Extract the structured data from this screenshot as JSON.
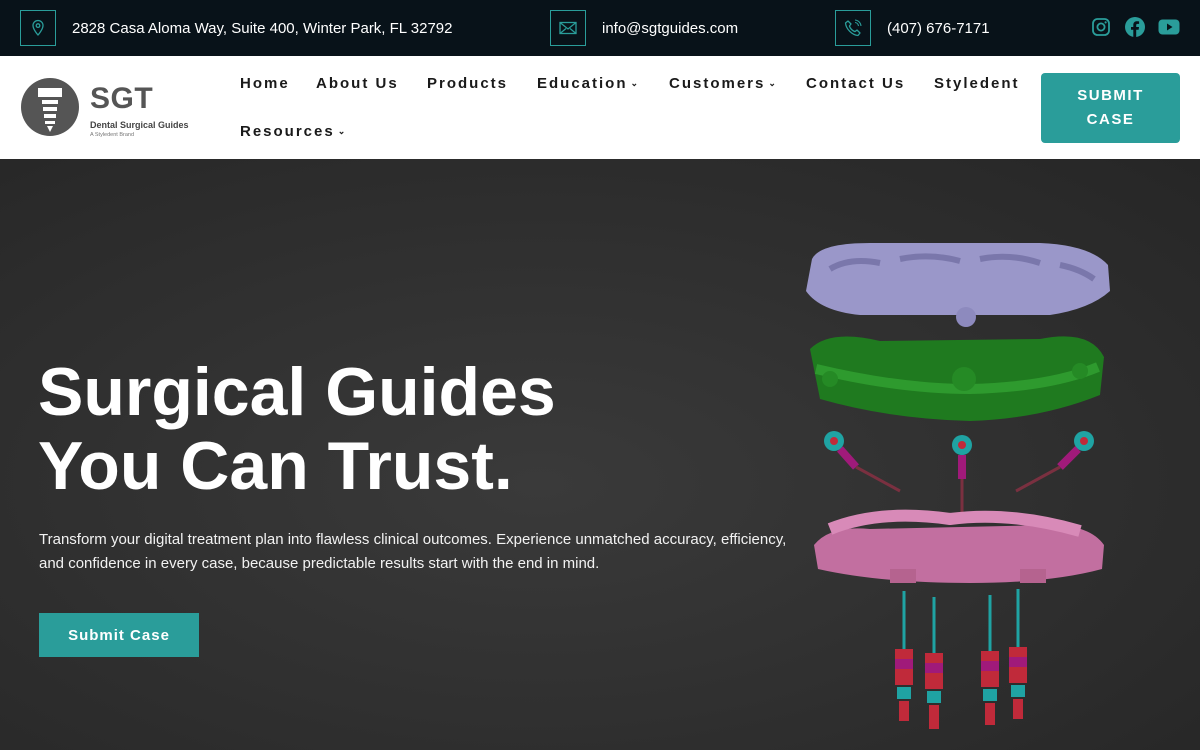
{
  "topbar": {
    "address": "2828 Casa Aloma Way, Suite 400, Winter Park, FL 32792",
    "email": "info@sgtguides.com",
    "phone": "(407) 676-7171",
    "address_icon": "map-pin-icon",
    "email_icon": "envelope-icon",
    "phone_icon": "phone-icon",
    "socials": [
      "instagram-icon",
      "facebook-icon",
      "youtube-icon"
    ],
    "accent": "#2a9d9a",
    "background": "#081219"
  },
  "logo": {
    "brand": "SGT",
    "tagline": "Dental Surgical Guides",
    "subtitle": "A Styledent Brand"
  },
  "nav": {
    "items": [
      {
        "label": "Home",
        "dropdown": false
      },
      {
        "label": "About Us",
        "dropdown": false
      },
      {
        "label": "Products",
        "dropdown": false
      },
      {
        "label": "Education",
        "dropdown": true
      },
      {
        "label": "Customers",
        "dropdown": true
      },
      {
        "label": "Contact Us",
        "dropdown": false
      },
      {
        "label": "Styledent",
        "dropdown": false
      },
      {
        "label": "Resources",
        "dropdown": true
      }
    ],
    "chevron": "⌄",
    "cta": "SUBMIT\nCASE"
  },
  "hero": {
    "title_line1": "Surgical Guides",
    "title_line2": "You Can Trust.",
    "description": "Transform your digital treatment plan into flawless clinical outcomes. Experience unmatched accuracy, efficiency, and confidence in every case, because predictable results start with the end in mind.",
    "button": "Submit Case",
    "illustration": "exploded-surgical-guide-illustration"
  }
}
